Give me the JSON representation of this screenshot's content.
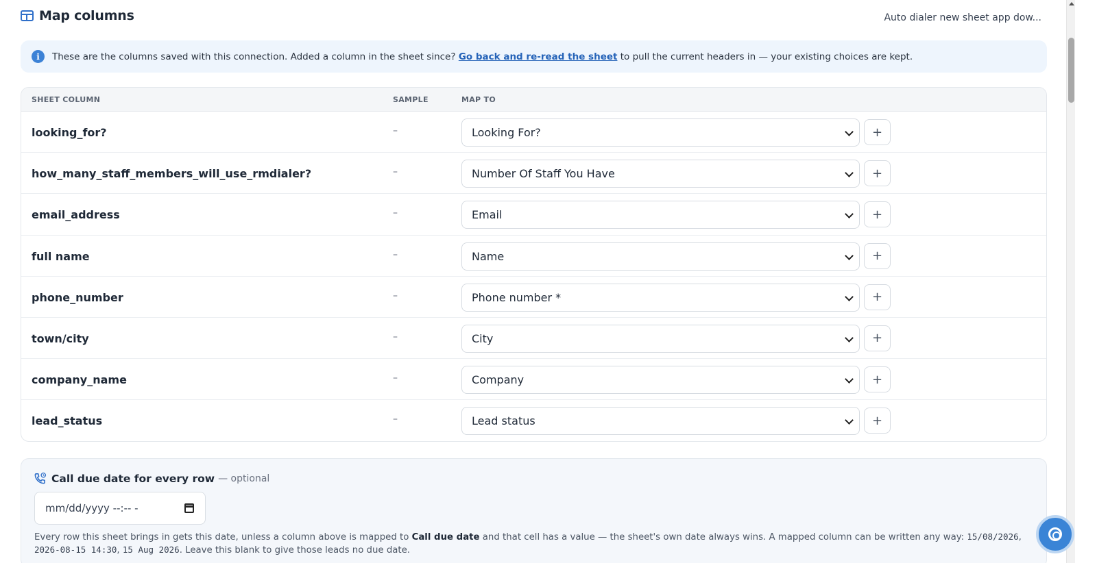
{
  "header": {
    "title": "Map columns",
    "sheet_name": "Auto dialer new sheet app dow..."
  },
  "info": {
    "text_before": "These are the columns saved with this connection. Added a column in the sheet since? ",
    "link": "Go back and re-read the sheet",
    "text_after": " to pull the current headers in — your existing choices are kept."
  },
  "table": {
    "headers": {
      "sheet_column": "SHEET COLUMN",
      "sample": "SAMPLE",
      "map_to": "MAP TO"
    },
    "plus_label": "+",
    "rows": [
      {
        "column": "looking_for?",
        "sample": "–",
        "map_to": "Looking For?"
      },
      {
        "column": "how_many_staff_members_will_use_rmdialer?",
        "sample": "–",
        "map_to": "Number Of Staff You Have"
      },
      {
        "column": "email_address",
        "sample": "–",
        "map_to": "Email"
      },
      {
        "column": "full name",
        "sample": "–",
        "map_to": "Name"
      },
      {
        "column": "phone_number",
        "sample": "–",
        "map_to": "Phone number *"
      },
      {
        "column": "town/city",
        "sample": "–",
        "map_to": "City"
      },
      {
        "column": "company_name",
        "sample": "–",
        "map_to": "Company"
      },
      {
        "column": "lead_status",
        "sample": "–",
        "map_to": "Lead status"
      }
    ]
  },
  "due_date": {
    "title": "Call due date for every row",
    "optional": "— optional",
    "input_placeholder": "mm/dd/yyyy --:-- -",
    "help_1": "Every row this sheet brings in gets this date, unless a column above is mapped to ",
    "help_bold": "Call due date",
    "help_2": " and that cell has a value — the sheet's own date always wins. A mapped column can be written any way: ",
    "ex1": "15/08/2026",
    "ex2": "2026-08-15 14:30",
    "ex3": "15 Aug 2026",
    "help_3": ". Leave this blank to give those leads no due date."
  },
  "icons": {
    "title_icon": "columns-grid-icon",
    "info_icon": "info-icon",
    "row_select": "chevron-down-icon",
    "row_add": "plus-icon",
    "due_icon": "phone-clock-icon",
    "date_picker": "calendar-icon",
    "help": "lifebuoy-icon"
  },
  "colors": {
    "accent": "#3a84d6",
    "link": "#2563b8",
    "info_bg": "#eef5fd"
  }
}
